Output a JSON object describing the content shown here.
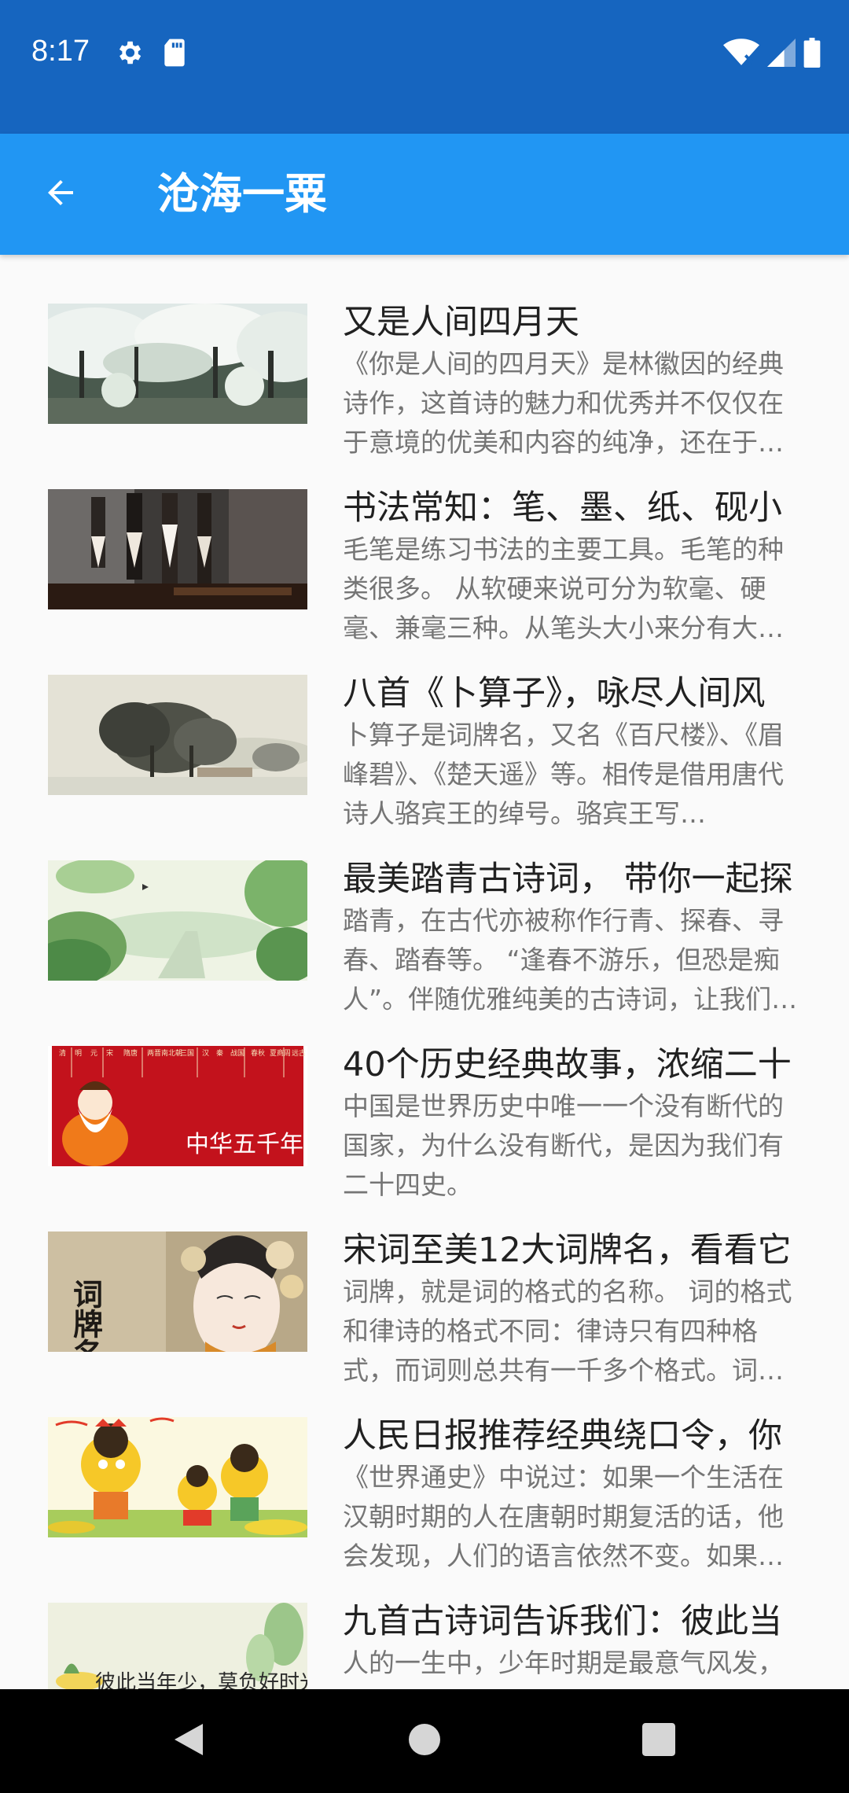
{
  "status": {
    "time": "8:17",
    "icons": [
      "gear-icon",
      "sd-card-icon",
      "wifi-icon",
      "signal-icon",
      "battery-icon"
    ]
  },
  "app_bar": {
    "title": "沧海一粟",
    "back_icon": "arrow-back-icon"
  },
  "articles": [
    {
      "title": "又是人间四月天",
      "summary": "《你是人间的四月天》是林徽因的经典诗作，这首诗的魅力和优秀并不仅仅在于意境的优美和内容的纯净，还在于…"
    },
    {
      "title": "书法常知：笔、墨、纸、砚小",
      "summary": "毛笔是练习书法的主要工具。毛笔的种类很多。 从软硬来说可分为软毫、硬毫、兼毫三种。从笔头大小来分有大…"
    },
    {
      "title": "八首《卜算子》，咏尽人间风",
      "summary": "卜算子是词牌名，又名《百尺楼》、《眉峰碧》、《楚天遥》等。相传是借用唐代诗人骆宾王的绰号。骆宾王写…"
    },
    {
      "title": "最美踏青古诗词， 带你一起探",
      "summary": "踏青，在古代亦被称作行青、探春、寻春、踏春等。 “逢春不游乐，但恐是痴人”。伴随优雅纯美的古诗词，让我们…"
    },
    {
      "title": "40个历史经典故事，浓缩二十",
      "summary": "中国是世界历史中唯一一个没有断代的国家，为什么没有断代，是因为我们有二十四史。",
      "thumb_text": [
        "清",
        "明",
        "元",
        "宋",
        "隋唐",
        "两晋南北朝",
        "三国",
        "汉",
        "秦",
        "战国",
        "春秋",
        "夏商周",
        "远古"
      ],
      "thumb_caption": "中华五千年"
    },
    {
      "title": "宋词至美12大词牌名，看看它",
      "summary": "词牌，就是词的格式的名称。 词的格式和律诗的格式不同：律诗只有四种格式，而词则总共有一千多个格式。词…",
      "thumb_caption": "词牌名"
    },
    {
      "title": "人民日报推荐经典绕口令，你",
      "summary": "《世界通史》中说过：如果一个生活在汉朝时期的人在唐朝时期复活的话，他会发现，人们的语言依然不变。如果…"
    },
    {
      "title": "九首古诗词告诉我们：彼此当",
      "summary": "人的一生中，少年时期是最意气风发，最是青春逼人。少年时，我们不知道光",
      "thumb_caption": "彼此当年少，莫负好时光"
    }
  ],
  "nav": {
    "back": "nav-back-icon",
    "home": "nav-home-icon",
    "recents": "nav-recents-icon"
  },
  "colors": {
    "status_bar": "#1665bf",
    "app_bar": "#2196f3",
    "title_text": "#212121",
    "summary_text": "#757575"
  }
}
